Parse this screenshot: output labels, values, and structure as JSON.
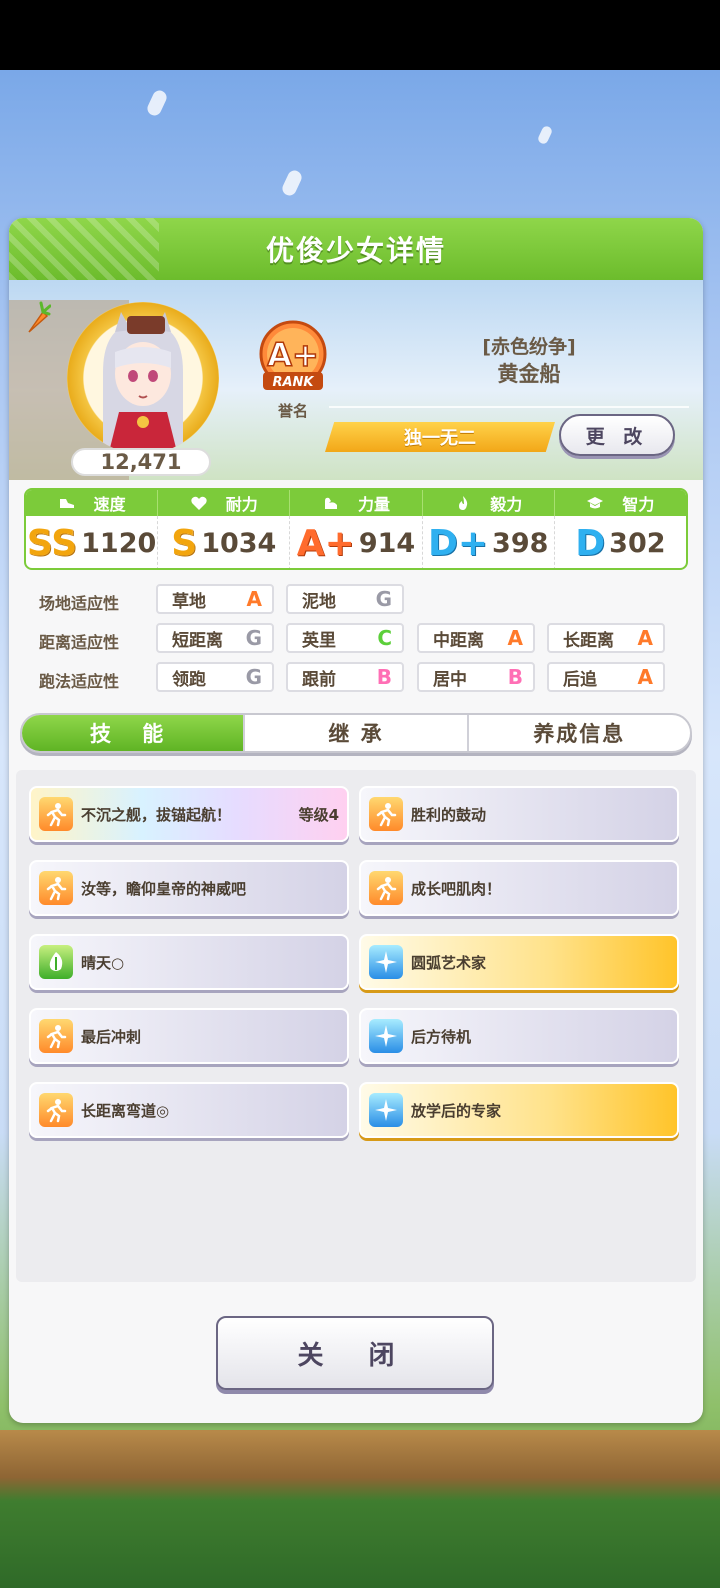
{
  "header": {
    "title": "优俊少女详情"
  },
  "profile": {
    "score": "12,471",
    "rank_badge": "A+",
    "rank_badge_text": "RANK",
    "rank_label": "誉名",
    "title": "[赤色纷争]",
    "name": "黄金船",
    "epithet": "独一无二",
    "change_label": "更 改"
  },
  "stats": [
    {
      "label": "速度",
      "icon": "shoe-icon",
      "grade": "SS",
      "value": "1120",
      "color": "#f2a50e"
    },
    {
      "label": "耐力",
      "icon": "heart-icon",
      "grade": "S",
      "value": "1034",
      "color": "#f2a50e"
    },
    {
      "label": "力量",
      "icon": "muscle-icon",
      "grade": "A+",
      "value": "914",
      "color": "#ff6b2d"
    },
    {
      "label": "毅力",
      "icon": "flame-icon",
      "grade": "D+",
      "value": "398",
      "color": "#2fb0f0"
    },
    {
      "label": "智力",
      "icon": "graduation-cap-icon",
      "grade": "D",
      "value": "302",
      "color": "#2fb0f0"
    }
  ],
  "aptitudes": {
    "track": {
      "label": "场地适应性",
      "items": [
        {
          "name": "草地",
          "grade": "A"
        },
        {
          "name": "泥地",
          "grade": "G"
        }
      ]
    },
    "distance": {
      "label": "距离适应性",
      "items": [
        {
          "name": "短距离",
          "grade": "G"
        },
        {
          "name": "英里",
          "grade": "C"
        },
        {
          "name": "中距离",
          "grade": "A"
        },
        {
          "name": "长距离",
          "grade": "A"
        }
      ]
    },
    "style": {
      "label": "跑法适应性",
      "items": [
        {
          "name": "领跑",
          "grade": "G"
        },
        {
          "name": "跟前",
          "grade": "B"
        },
        {
          "name": "居中",
          "grade": "B"
        },
        {
          "name": "后追",
          "grade": "A"
        }
      ]
    }
  },
  "grade_colors": {
    "A": "#ff7a2a",
    "B": "#ff6fb5",
    "C": "#5ccf3a",
    "G": "#9a9aa6"
  },
  "tabs": [
    {
      "label": "技 能",
      "active": true
    },
    {
      "label": "继 承",
      "active": false
    },
    {
      "label": "养成信息",
      "active": false
    }
  ],
  "skills": [
    {
      "name": "不沉之舰，拔锚起航！",
      "level": "等级4",
      "style": "rainbow",
      "icon": "orange"
    },
    {
      "name": "胜利的鼓动",
      "level": "",
      "style": "normal",
      "icon": "orange"
    },
    {
      "name": "汝等，瞻仰皇帝的神威吧",
      "level": "",
      "style": "normal",
      "icon": "orange"
    },
    {
      "name": "成长吧肌肉！",
      "level": "",
      "style": "normal",
      "icon": "orange"
    },
    {
      "name": "晴天○",
      "level": "",
      "style": "normal",
      "icon": "green"
    },
    {
      "name": "圆弧艺术家",
      "level": "",
      "style": "gold",
      "icon": "blue"
    },
    {
      "name": "最后冲刺",
      "level": "",
      "style": "normal",
      "icon": "orange"
    },
    {
      "name": "后方待机",
      "level": "",
      "style": "normal",
      "icon": "blue"
    },
    {
      "name": "长距离弯道◎",
      "level": "",
      "style": "normal",
      "icon": "orange"
    },
    {
      "name": "放学后的专家",
      "level": "",
      "style": "gold",
      "icon": "blue"
    }
  ],
  "close_label": "关 闭"
}
